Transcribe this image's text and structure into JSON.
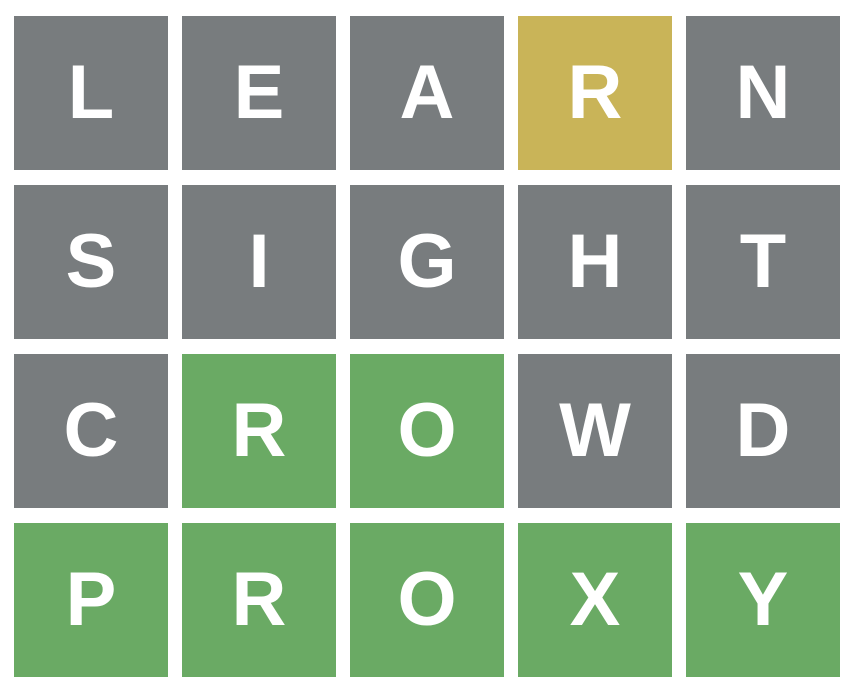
{
  "colors": {
    "absent": "#787c7e",
    "present": "#c9b458",
    "correct": "#6aaa64",
    "text": "#ffffff"
  },
  "board": {
    "rows": [
      {
        "tiles": [
          {
            "letter": "L",
            "state": "absent"
          },
          {
            "letter": "E",
            "state": "absent"
          },
          {
            "letter": "A",
            "state": "absent"
          },
          {
            "letter": "R",
            "state": "present"
          },
          {
            "letter": "N",
            "state": "absent"
          }
        ]
      },
      {
        "tiles": [
          {
            "letter": "S",
            "state": "absent"
          },
          {
            "letter": "I",
            "state": "absent"
          },
          {
            "letter": "G",
            "state": "absent"
          },
          {
            "letter": "H",
            "state": "absent"
          },
          {
            "letter": "T",
            "state": "absent"
          }
        ]
      },
      {
        "tiles": [
          {
            "letter": "C",
            "state": "absent"
          },
          {
            "letter": "R",
            "state": "correct"
          },
          {
            "letter": "O",
            "state": "correct"
          },
          {
            "letter": "W",
            "state": "absent"
          },
          {
            "letter": "D",
            "state": "absent"
          }
        ]
      },
      {
        "tiles": [
          {
            "letter": "P",
            "state": "correct"
          },
          {
            "letter": "R",
            "state": "correct"
          },
          {
            "letter": "O",
            "state": "correct"
          },
          {
            "letter": "X",
            "state": "correct"
          },
          {
            "letter": "Y",
            "state": "correct"
          }
        ]
      }
    ]
  }
}
